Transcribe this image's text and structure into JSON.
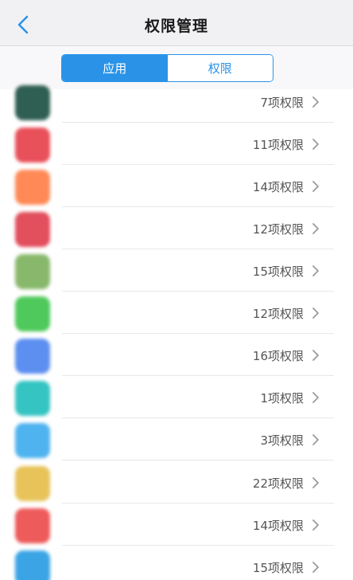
{
  "header": {
    "title": "权限管理",
    "back_icon": "back-arrow-icon"
  },
  "tabs": [
    {
      "label": "应用",
      "active": true
    },
    {
      "label": "权限",
      "active": false
    }
  ],
  "colors": {
    "accent": "#2a93e8"
  },
  "apps": [
    {
      "name": "",
      "permissions": "7项权限",
      "icon_color": "#2f5f52"
    },
    {
      "name": "",
      "permissions": "11项权限",
      "icon_color": "#e8505a"
    },
    {
      "name": "",
      "permissions": "14项权限",
      "icon_color": "#ff8a57"
    },
    {
      "name": "",
      "permissions": "12项权限",
      "icon_color": "#e24f5d"
    },
    {
      "name": "",
      "permissions": "15项权限",
      "icon_color": "#88b86b"
    },
    {
      "name": "",
      "permissions": "12项权限",
      "icon_color": "#4fc95b"
    },
    {
      "name": "",
      "permissions": "16项权限",
      "icon_color": "#5c8ff0"
    },
    {
      "name": "",
      "permissions": "1项权限",
      "icon_color": "#35c4c2"
    },
    {
      "name": "",
      "permissions": "3项权限",
      "icon_color": "#4fb3ef"
    },
    {
      "name": "",
      "permissions": "22项权限",
      "icon_color": "#e7c35a"
    },
    {
      "name": "",
      "permissions": "14项权限",
      "icon_color": "#ee5b5b"
    },
    {
      "name": "",
      "permissions": "15项权限",
      "icon_color": "#3aa4e5"
    }
  ]
}
